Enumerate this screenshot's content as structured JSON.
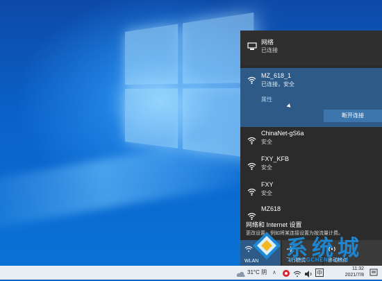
{
  "flyout": {
    "header": {
      "title": "网络",
      "status": "已连接"
    },
    "active_network": {
      "name": "MZ_618_1",
      "status": "已连接，安全",
      "properties": "属性",
      "disconnect": "断开连接"
    },
    "networks": [
      {
        "name": "ChinaNet-gS6a",
        "security": "安全"
      },
      {
        "name": "FXY_KFB",
        "security": "安全"
      },
      {
        "name": "FXY",
        "security": "安全"
      },
      {
        "name": "MZ618",
        "security": ""
      }
    ],
    "settings": {
      "title": "网络和 Internet 设置",
      "desc": "更改设置，例如将某连接设置为按流量计费。"
    },
    "tiles": [
      {
        "label": "WLAN",
        "on": true
      },
      {
        "label": "飞行模式",
        "on": false
      },
      {
        "label": "移动热点",
        "on": false
      }
    ]
  },
  "taskbar": {
    "weather": "31°C 阴",
    "time": "11:32",
    "date": "2021/7/8"
  },
  "watermark": {
    "cn": "系统城",
    "en": "XITONGCHENG.COM"
  }
}
